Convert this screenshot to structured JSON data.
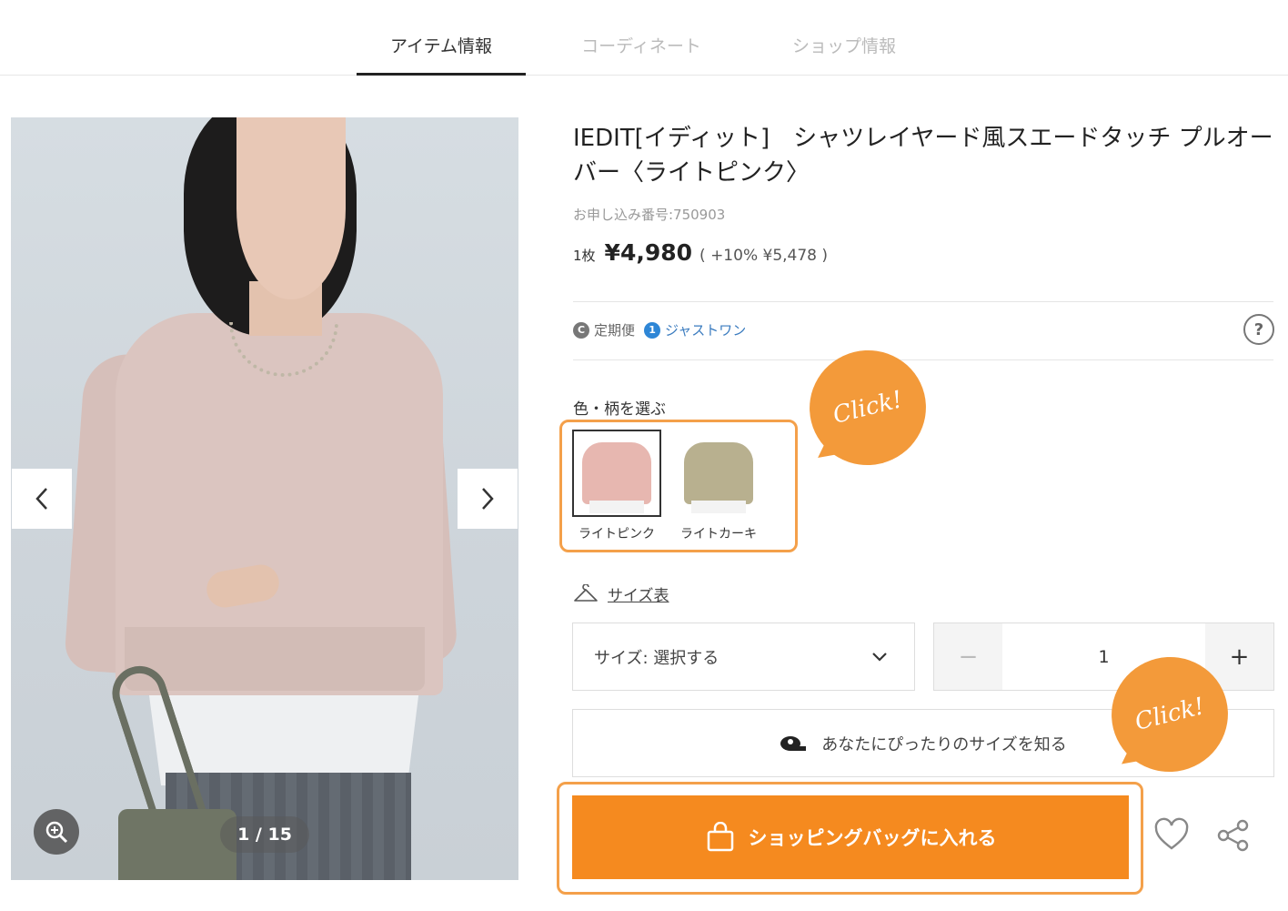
{
  "tabs": [
    {
      "label": "アイテム情報",
      "active": true
    },
    {
      "label": "コーディネート",
      "active": false
    },
    {
      "label": "ショップ情報",
      "active": false
    }
  ],
  "gallery": {
    "counter": "1 / 15",
    "prev_icon": "chevron-left-icon",
    "next_icon": "chevron-right-icon",
    "zoom_icon": "zoom-in-icon"
  },
  "product": {
    "title": "IEDIT[イディット]　シャツレイヤード風スエードタッチ プルオーバー〈ライトピンク〉",
    "order_number": "お申し込み番号:750903",
    "qty_unit": "1枚",
    "price": "¥4,980",
    "tax_price": "( +10%  ¥5,478 )"
  },
  "services": {
    "teiki": "定期便",
    "just_one": "ジャストワン",
    "help_icon": "?"
  },
  "colors": {
    "label": "色・柄を選ぶ",
    "options": [
      {
        "name": "ライトピンク",
        "swatch": "#e7b7b0",
        "selected": true
      },
      {
        "name": "ライトカーキ",
        "swatch": "#b8b08f",
        "selected": false
      }
    ]
  },
  "size_chart": {
    "label": "サイズ表",
    "icon": "hanger-icon"
  },
  "size_select": {
    "label": "サイズ:  選択する"
  },
  "quantity": {
    "minus": "−",
    "value": "1",
    "plus": "+"
  },
  "fit_button": {
    "label": "あなたにぴったりのサイズを知る",
    "icon": "measuring-tape-icon"
  },
  "cart_button": {
    "label": "ショッピングバッグに入れる",
    "icon": "shopping-bag-icon"
  },
  "callouts": {
    "bubble1": "Click!",
    "bubble2": "Click!"
  },
  "accent_colors": {
    "orange": "#f58a1f",
    "highlight": "#f4a04a",
    "link_blue": "#3a7bbf"
  }
}
